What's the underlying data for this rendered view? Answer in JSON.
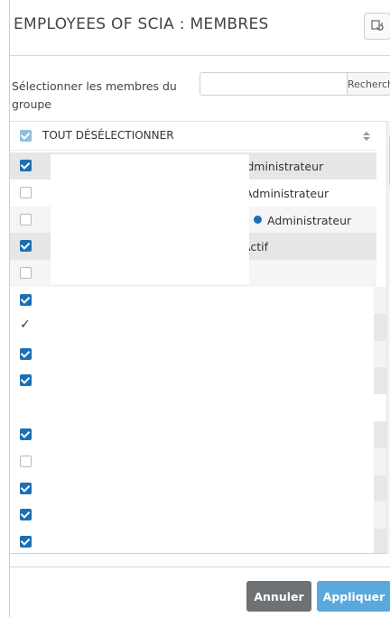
{
  "dialog": {
    "title": "EMPLOYEES OF SCIA : MEMBRES",
    "select_label": "Sélectionner les membres du groupe",
    "search": {
      "value": "",
      "placeholder": "",
      "button_label": "Rechercher"
    }
  },
  "list": {
    "header": {
      "label": "TOUT DÉSÉLECTIONNER",
      "checked": true
    },
    "rows": [
      {
        "mark": "checked",
        "role": "Administrateur"
      },
      {
        "mark": "unchecked",
        "role": "Administrateur"
      },
      {
        "mark": "unchecked",
        "prefix": ">",
        "role": "Administrateur"
      },
      {
        "mark": "checked",
        "role": "Actif"
      },
      {
        "mark": "unchecked",
        "role": ""
      },
      {
        "mark": "checked",
        "role": ""
      },
      {
        "mark": "tick",
        "role": ""
      },
      {
        "mark": "checked",
        "role": ""
      },
      {
        "mark": "checked",
        "role": ""
      },
      {
        "mark": "none",
        "role": ""
      },
      {
        "mark": "checked",
        "role": ""
      },
      {
        "mark": "unchecked",
        "role": ""
      },
      {
        "mark": "checked",
        "role": ""
      },
      {
        "mark": "checked",
        "role": ""
      },
      {
        "mark": "checked",
        "role": ""
      }
    ]
  },
  "footer": {
    "cancel_label": "Annuler",
    "apply_label": "Appliquer"
  },
  "colors": {
    "accent": "#1c6fb3",
    "apply": "#5aa9dc",
    "cancel": "#6f7274",
    "status_dot": "#1c6fb3"
  }
}
